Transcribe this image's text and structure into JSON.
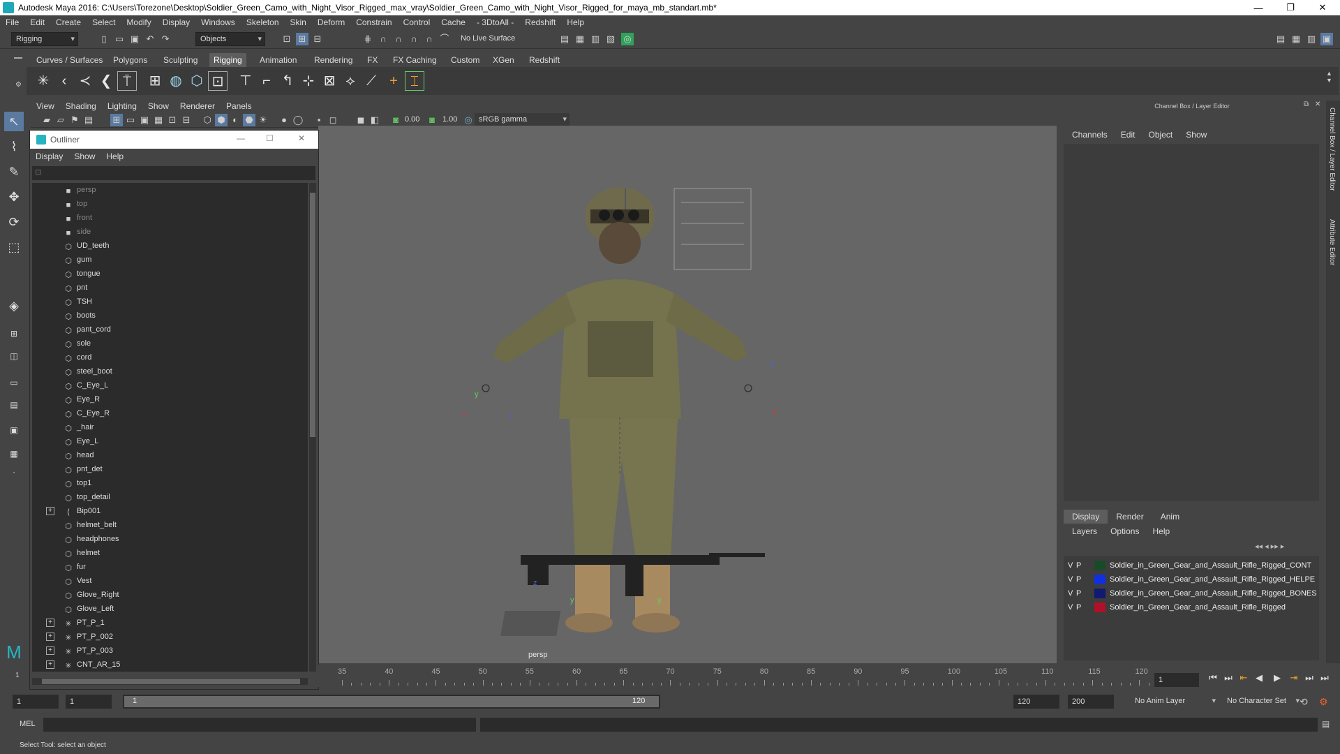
{
  "window": {
    "title": "Autodesk Maya 2016: C:\\Users\\Torezone\\Desktop\\Soldier_Green_Camo_with_Night_Visor_Rigged_max_vray\\Soldier_Green_Camo_with_Night_Visor_Rigged_for_maya_mb_standart.mb*",
    "minimize": "—",
    "maximize": "❐",
    "close": "✕"
  },
  "menubar": [
    "File",
    "Edit",
    "Create",
    "Select",
    "Modify",
    "Display",
    "Windows",
    "Skeleton",
    "Skin",
    "Deform",
    "Constrain",
    "Control",
    "Cache",
    "- 3DtoAll -",
    "Redshift",
    "Help"
  ],
  "statusline": {
    "mode": "Rigging",
    "objects": "Objects",
    "live_surface": "No Live Surface"
  },
  "shelf": {
    "tabs": [
      "Curves / Surfaces",
      "Polygons",
      "Sculpting",
      "Rigging",
      "Animation",
      "Rendering",
      "FX",
      "FX Caching",
      "Custom",
      "XGen",
      "Redshift"
    ],
    "active_tab": "Rigging"
  },
  "panel": {
    "menus": [
      "View",
      "Shading",
      "Lighting",
      "Show",
      "Renderer",
      "Panels"
    ],
    "exposure": "0.00",
    "gamma": "1.00",
    "color_space": "sRGB gamma",
    "camera_label": "persp"
  },
  "outliner": {
    "title": "Outliner",
    "menus": [
      "Display",
      "Show",
      "Help"
    ],
    "items": [
      {
        "label": "persp",
        "type": "camera",
        "dim": true,
        "expand": false
      },
      {
        "label": "top",
        "type": "camera",
        "dim": true,
        "expand": false
      },
      {
        "label": "front",
        "type": "camera",
        "dim": true,
        "expand": false
      },
      {
        "label": "side",
        "type": "camera",
        "dim": true,
        "expand": false
      },
      {
        "label": "UD_teeth",
        "type": "mesh",
        "dim": false,
        "expand": false
      },
      {
        "label": "gum",
        "type": "mesh",
        "dim": false,
        "expand": false
      },
      {
        "label": "tongue",
        "type": "mesh",
        "dim": false,
        "expand": false
      },
      {
        "label": "pnt",
        "type": "mesh",
        "dim": false,
        "expand": false
      },
      {
        "label": "TSH",
        "type": "mesh",
        "dim": false,
        "expand": false
      },
      {
        "label": "boots",
        "type": "mesh",
        "dim": false,
        "expand": false
      },
      {
        "label": "pant_cord",
        "type": "mesh",
        "dim": false,
        "expand": false
      },
      {
        "label": "sole",
        "type": "mesh",
        "dim": false,
        "expand": false
      },
      {
        "label": "cord",
        "type": "mesh",
        "dim": false,
        "expand": false
      },
      {
        "label": "steel_boot",
        "type": "mesh",
        "dim": false,
        "expand": false
      },
      {
        "label": "C_Eye_L",
        "type": "mesh",
        "dim": false,
        "expand": false
      },
      {
        "label": "Eye_R",
        "type": "mesh",
        "dim": false,
        "expand": false
      },
      {
        "label": "C_Eye_R",
        "type": "mesh",
        "dim": false,
        "expand": false
      },
      {
        "label": "_hair",
        "type": "mesh",
        "dim": false,
        "expand": false
      },
      {
        "label": "Eye_L",
        "type": "mesh",
        "dim": false,
        "expand": false
      },
      {
        "label": "head",
        "type": "mesh",
        "dim": false,
        "expand": false
      },
      {
        "label": "pnt_det",
        "type": "mesh",
        "dim": false,
        "expand": false
      },
      {
        "label": "top1",
        "type": "mesh",
        "dim": false,
        "expand": false
      },
      {
        "label": "top_detail",
        "type": "mesh",
        "dim": false,
        "expand": false
      },
      {
        "label": "Bip001",
        "type": "joint",
        "dim": false,
        "expand": true
      },
      {
        "label": "helmet_belt",
        "type": "mesh",
        "dim": false,
        "expand": false
      },
      {
        "label": "headphones",
        "type": "mesh",
        "dim": false,
        "expand": false
      },
      {
        "label": "helmet",
        "type": "mesh",
        "dim": false,
        "expand": false
      },
      {
        "label": "fur",
        "type": "mesh",
        "dim": false,
        "expand": false
      },
      {
        "label": "Vest",
        "type": "mesh",
        "dim": false,
        "expand": false
      },
      {
        "label": "Glove_Right",
        "type": "mesh",
        "dim": false,
        "expand": false
      },
      {
        "label": "Glove_Left",
        "type": "mesh",
        "dim": false,
        "expand": false
      },
      {
        "label": "PT_P_1",
        "type": "locator",
        "dim": false,
        "expand": true
      },
      {
        "label": "PT_P_002",
        "type": "locator",
        "dim": false,
        "expand": true
      },
      {
        "label": "PT_P_003",
        "type": "locator",
        "dim": false,
        "expand": true
      },
      {
        "label": "CNT_AR_15",
        "type": "locator",
        "dim": false,
        "expand": true
      }
    ]
  },
  "channelbox": {
    "title": "Channel Box / Layer Editor",
    "menus": [
      "Channels",
      "Edit",
      "Object",
      "Show"
    ],
    "layer_tabs": [
      "Display",
      "Render",
      "Anim"
    ],
    "active_layer_tab": "Display",
    "layer_menus": [
      "Layers",
      "Options",
      "Help"
    ],
    "layers": [
      {
        "v": "V",
        "p": "P",
        "color": "#1a4a2a",
        "name": "Soldier_in_Green_Gear_and_Assault_Rifle_Rigged_CONT"
      },
      {
        "v": "V",
        "p": "P",
        "color": "#1030e0",
        "name": "Soldier_in_Green_Gear_and_Assault_Rifle_Rigged_HELPE"
      },
      {
        "v": "V",
        "p": "P",
        "color": "#101a70",
        "name": "Soldier_in_Green_Gear_and_Assault_Rifle_Rigged_BONES"
      },
      {
        "v": "V",
        "p": "P",
        "color": "#b0102a",
        "name": "Soldier_in_Green_Gear_and_Assault_Rifle_Rigged"
      }
    ],
    "side_tabs": [
      "Channel Box / Layer Editor",
      "Attribute Editor"
    ]
  },
  "timeline": {
    "ticks": [
      "35",
      "40",
      "45",
      "50",
      "55",
      "60",
      "65",
      "70",
      "75",
      "80",
      "85",
      "90",
      "95",
      "100",
      "105",
      "110",
      "115",
      "120"
    ],
    "current_frame": "1",
    "range_start": "1",
    "range_start_inner": "1",
    "range_slider_start": "1",
    "range_slider_end": "120",
    "range_end": "120",
    "anim_end": "200",
    "anim_layer": "No Anim Layer",
    "character_set": "No Character Set",
    "frame_left": "1"
  },
  "mel": {
    "label": "MEL"
  },
  "helpline": "Select Tool: select an object"
}
